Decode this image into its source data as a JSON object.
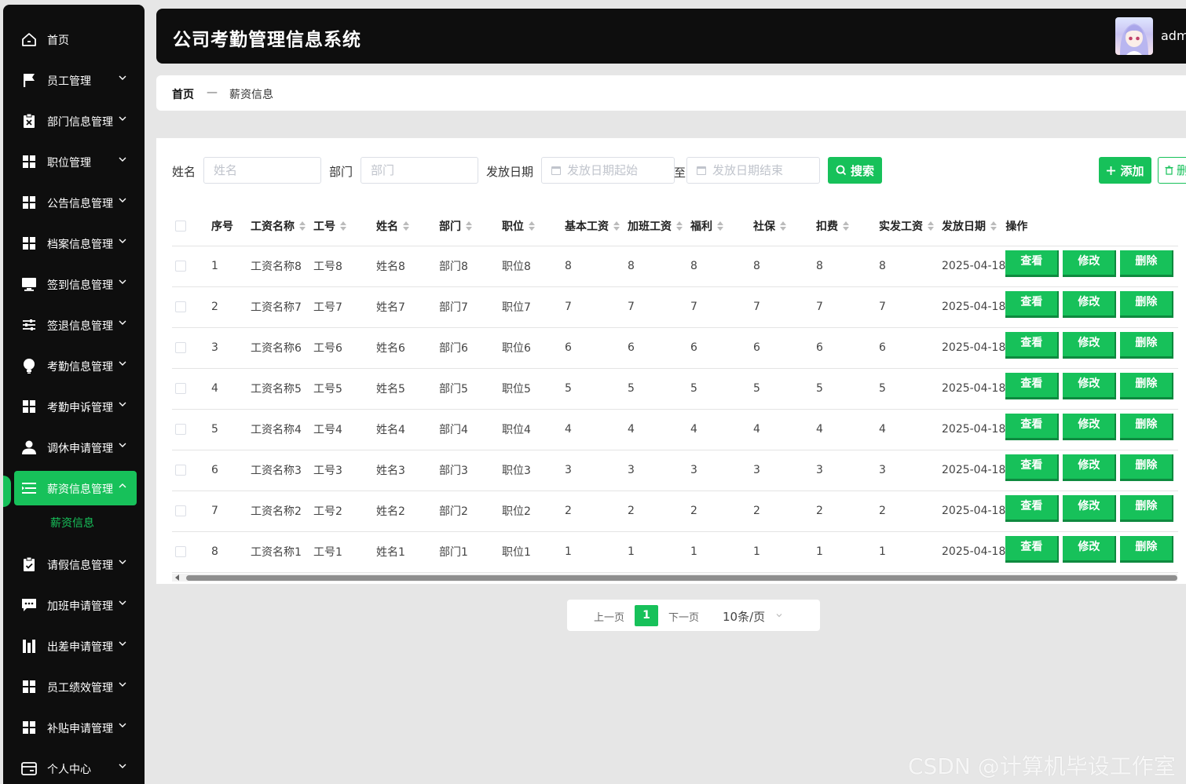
{
  "app": {
    "title": "公司考勤管理信息系统",
    "username": "adm"
  },
  "sidebar": {
    "items": [
      {
        "label": "首页",
        "icon": "home-icon",
        "expandable": false
      },
      {
        "label": "员工管理",
        "icon": "flag-icon",
        "expandable": true
      },
      {
        "label": "部门信息管理",
        "icon": "clipboard-x-icon",
        "expandable": true
      },
      {
        "label": "职位管理",
        "icon": "grid-icon",
        "expandable": true
      },
      {
        "label": "公告信息管理",
        "icon": "grid-icon",
        "expandable": true
      },
      {
        "label": "档案信息管理",
        "icon": "grid-icon",
        "expandable": true
      },
      {
        "label": "签到信息管理",
        "icon": "monitor-icon",
        "expandable": true
      },
      {
        "label": "签退信息管理",
        "icon": "sliders-icon",
        "expandable": true
      },
      {
        "label": "考勤信息管理",
        "icon": "bulb-icon",
        "expandable": true
      },
      {
        "label": "考勤申诉管理",
        "icon": "grid-icon",
        "expandable": true
      },
      {
        "label": "调休申请管理",
        "icon": "user-icon",
        "expandable": true
      },
      {
        "label": "薪资信息管理",
        "icon": "list-icon",
        "expandable": true,
        "active": true
      },
      {
        "label": "请假信息管理",
        "icon": "clipboard-check-icon",
        "expandable": true
      },
      {
        "label": "加班申请管理",
        "icon": "chat-icon",
        "expandable": true
      },
      {
        "label": "出差申请管理",
        "icon": "chart-bars-icon",
        "expandable": true
      },
      {
        "label": "员工绩效管理",
        "icon": "grid-icon",
        "expandable": true
      },
      {
        "label": "补贴申请管理",
        "icon": "grid-icon",
        "expandable": true
      },
      {
        "label": "个人中心",
        "icon": "card-icon",
        "expandable": true
      }
    ],
    "active_sub_item": "薪资信息"
  },
  "breadcrumb": {
    "home": "首页",
    "separator": "—",
    "current": "薪资信息"
  },
  "search": {
    "name_label": "姓名",
    "name_placeholder": "姓名",
    "dept_label": "部门",
    "dept_placeholder": "部门",
    "date_label": "发放日期",
    "date_start_placeholder": "发放日期起始",
    "date_to": "至",
    "date_end_placeholder": "发放日期结束",
    "search_button": "搜索",
    "add_button": "添加",
    "delete_button": "删"
  },
  "table": {
    "columns": [
      "序号",
      "工资名称",
      "工号",
      "姓名",
      "部门",
      "职位",
      "基本工资",
      "加班工资",
      "福利",
      "社保",
      "扣费",
      "实发工资",
      "发放日期",
      "操作"
    ],
    "rows": [
      [
        "1",
        "工资名称8",
        "工号8",
        "姓名8",
        "部门8",
        "职位8",
        "8",
        "8",
        "8",
        "8",
        "8",
        "8",
        "2025-04-18"
      ],
      [
        "2",
        "工资名称7",
        "工号7",
        "姓名7",
        "部门7",
        "职位7",
        "7",
        "7",
        "7",
        "7",
        "7",
        "7",
        "2025-04-18"
      ],
      [
        "3",
        "工资名称6",
        "工号6",
        "姓名6",
        "部门6",
        "职位6",
        "6",
        "6",
        "6",
        "6",
        "6",
        "6",
        "2025-04-18"
      ],
      [
        "4",
        "工资名称5",
        "工号5",
        "姓名5",
        "部门5",
        "职位5",
        "5",
        "5",
        "5",
        "5",
        "5",
        "5",
        "2025-04-18"
      ],
      [
        "5",
        "工资名称4",
        "工号4",
        "姓名4",
        "部门4",
        "职位4",
        "4",
        "4",
        "4",
        "4",
        "4",
        "4",
        "2025-04-18"
      ],
      [
        "6",
        "工资名称3",
        "工号3",
        "姓名3",
        "部门3",
        "职位3",
        "3",
        "3",
        "3",
        "3",
        "3",
        "3",
        "2025-04-18"
      ],
      [
        "7",
        "工资名称2",
        "工号2",
        "姓名2",
        "部门2",
        "职位2",
        "2",
        "2",
        "2",
        "2",
        "2",
        "2",
        "2025-04-18"
      ],
      [
        "8",
        "工资名称1",
        "工号1",
        "姓名1",
        "部门1",
        "职位1",
        "1",
        "1",
        "1",
        "1",
        "1",
        "1",
        "2025-04-18"
      ]
    ],
    "actions": [
      "查看",
      "修改",
      "删除"
    ]
  },
  "pagination": {
    "prev": "上一页",
    "current_page": "1",
    "next": "下一页",
    "page_size": "10条/页"
  },
  "watermark": "CSDN @计算机毕设工作室",
  "colors": {
    "accent": "#17c15a",
    "sidebar_bg": "#0e0e0e",
    "header_bg": "#0e0e0e",
    "page_bg": "#e6e6e6"
  }
}
